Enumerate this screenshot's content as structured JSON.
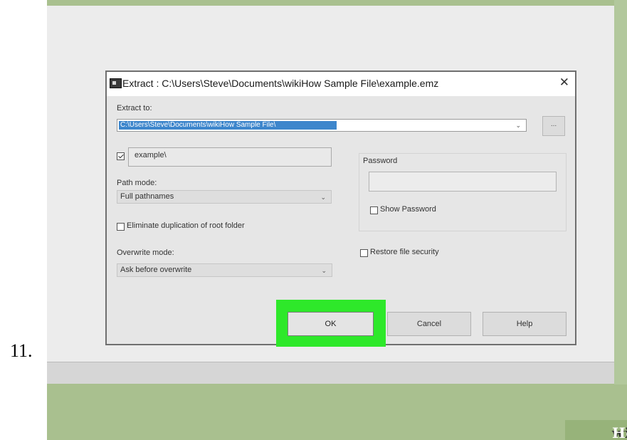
{
  "step_number": "11.",
  "dialog": {
    "title": "Extract : C:\\Users\\Steve\\Documents\\wikiHow Sample File\\example.emz",
    "close_glyph": "✕",
    "extract_to_label": "Extract to:",
    "extract_to_value": "C:\\Users\\Steve\\Documents\\wikiHow Sample File\\",
    "browse_label": "...",
    "folder_name": "example\\",
    "folder_name_checked": true,
    "path_mode_label": "Path mode:",
    "path_mode_value": "Full pathnames",
    "eliminate_duplication_label": "Eliminate duplication of root folder",
    "eliminate_duplication_checked": false,
    "overwrite_mode_label": "Overwrite mode:",
    "overwrite_mode_value": "Ask before overwrite",
    "password_label": "Password",
    "password_value": "",
    "show_password_label": "Show Password",
    "show_password_checked": false,
    "restore_security_label": "Restore file security",
    "restore_security_checked": false,
    "ok_label": "OK",
    "cancel_label": "Cancel",
    "help_label": "Help",
    "dropdown_glyph": "⌄"
  },
  "highlight_color": "#2ee82a",
  "watermark": {
    "wiki": "wiki",
    "how": "How"
  }
}
